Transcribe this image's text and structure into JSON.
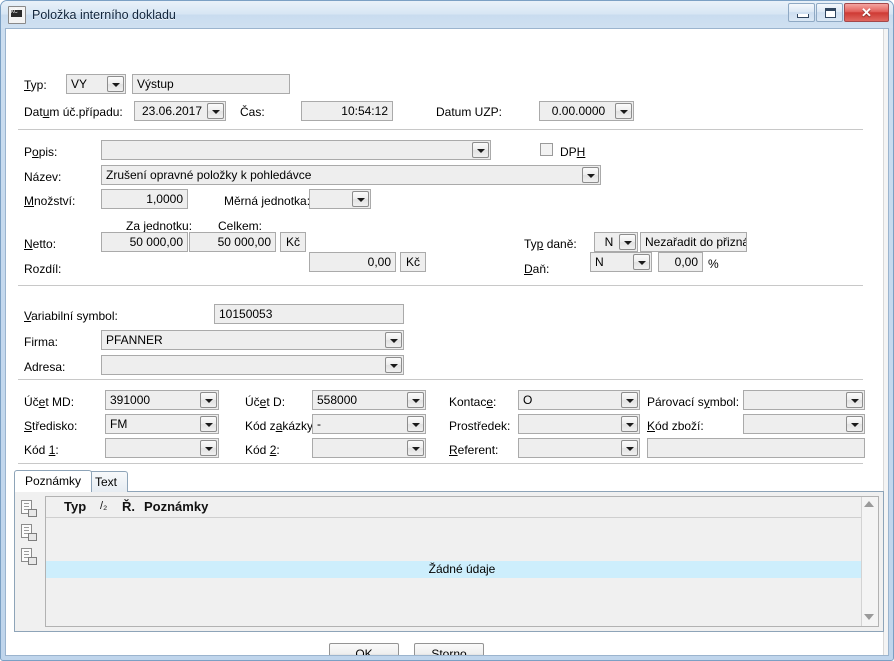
{
  "window": {
    "title": "Položka interního dokladu",
    "icon": "document-kc-icon",
    "buttons": {
      "minimize": "minimize-icon",
      "maximize": "maximize-icon",
      "close": "✕"
    },
    "accent_title_color": "#10243b",
    "frame_color": "#c5d9ee",
    "close_color": "#cf3a34"
  },
  "section_header": {
    "typ_label": "Typ:",
    "typ_code": "VY",
    "typ_name": "Výstup",
    "datum_label": "Datum úč.případu:",
    "datum_value": "23.06.2017",
    "cas_label": "Čas:",
    "cas_value": "10:54:12",
    "uzp_label": "Datum UZP:",
    "uzp_value": "0.00.0000"
  },
  "section_item": {
    "popis_label": "Popis:",
    "popis_value": "",
    "dph_label": "DPH",
    "dph_checked": false,
    "nazev_label": "Název:",
    "nazev_value": "Zrušení opravné položky k pohledávce",
    "mnozstvi_label": "Množství:",
    "mnozstvi_value": "1,0000",
    "merna_jednotka_label": "Měrná jednotka:",
    "merna_jednotka_value": "",
    "za_jednotku_label": "Za jednotku:",
    "celkem_label": "Celkem:",
    "netto_label": "Netto:",
    "netto_unit": "50 000,00",
    "netto_total": "50 000,00",
    "netto_currency": "Kč",
    "rozdil_label": "Rozdíl:",
    "rozdil_value": "0,00",
    "rozdil_currency": "Kč",
    "typ_dane_label": "Typ daně:",
    "typ_dane_code": "N",
    "typ_dane_text": "Nezařadit do přiznání",
    "dan_label": "Daň:",
    "dan_code": "N",
    "dan_value": "0,00",
    "dan_unit": "%"
  },
  "section_partner": {
    "variabilni_symbol_label": "Variabilní symbol:",
    "variabilni_symbol_value": "10150053",
    "firma_label": "Firma:",
    "firma_value": "PFANNER",
    "adresa_label": "Adresa:",
    "adresa_value": ""
  },
  "section_accounts": {
    "ucet_md_label": "Účet MD:",
    "ucet_md_value": "391000",
    "ucet_d_label": "Účet D:",
    "ucet_d_value": "558000",
    "kontace_label": "Kontace:",
    "kontace_value": "O",
    "parovaci_symbol_label": "Párovací symbol:",
    "parovaci_symbol_value": "",
    "stredisko_label": "Středisko:",
    "stredisko_value": "FM",
    "kod_zakazky_label": "Kód zakázky:",
    "kod_zakazky_value": "-",
    "prostredek_label": "Prostředek:",
    "prostredek_value": "",
    "kod_zbozi_label": "Kód zboží:",
    "kod_zbozi_value": "",
    "kod1_label": "Kód 1:",
    "kod1_value": "",
    "kod2_label": "Kód 2:",
    "kod2_value": "",
    "referent_label": "Referent:",
    "referent_value": "",
    "referent_extra_value": ""
  },
  "tabs": [
    {
      "label": "Poznámky",
      "active": true
    },
    {
      "label": "Text",
      "active": false
    }
  ],
  "notes_grid": {
    "columns": [
      "Typ",
      "/₂",
      "Ř.",
      "Poznámky"
    ],
    "empty_text": "Žádné údaje",
    "rows": [],
    "row_highlight_color": "#cdeefc",
    "rail_icons": [
      "document-add-icon",
      "document-edit-icon",
      "document-delete-icon"
    ],
    "scroll_up_icon": "scroll-up-arrow-icon",
    "scroll_down_icon": "scroll-down-arrow-icon"
  },
  "footer": {
    "ok_label": "OK",
    "storno_label": "Storno"
  }
}
